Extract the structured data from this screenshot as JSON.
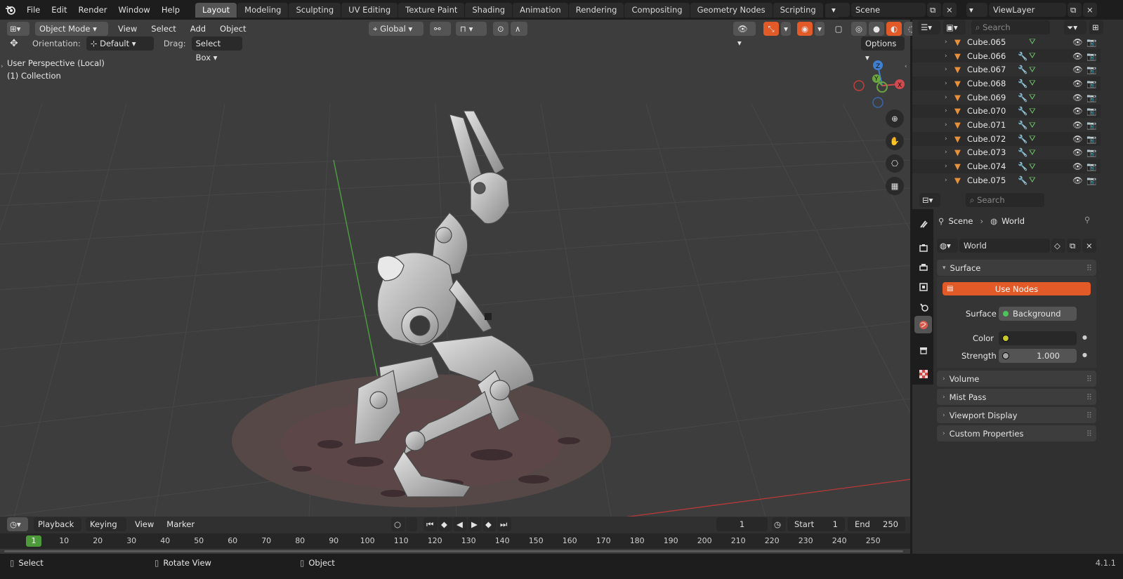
{
  "topbar": {
    "menus": [
      "File",
      "Edit",
      "Render",
      "Window",
      "Help"
    ],
    "tabs": [
      "Layout",
      "Modeling",
      "Sculpting",
      "UV Editing",
      "Texture Paint",
      "Shading",
      "Animation",
      "Rendering",
      "Compositing",
      "Geometry Nodes",
      "Scripting"
    ],
    "active_tab": "Layout",
    "add_label": "+",
    "scene_label": "Scene",
    "viewlayer_label": "ViewLayer"
  },
  "viewport": {
    "mode": "Object Mode",
    "menus": [
      "View",
      "Select",
      "Add",
      "Object"
    ],
    "transform_orientation": "Global",
    "orientation_label": "Orientation:",
    "orientation_value": "Default",
    "drag_label": "Drag:",
    "drag_value": "Select Box",
    "options_label": "Options",
    "overlay_title": "User Perspective (Local)",
    "overlay_collection": "(1) Collection",
    "gizmo": {
      "x": "X",
      "y": "Y",
      "z": "Z"
    }
  },
  "outliner": {
    "search_placeholder": "Search",
    "items": [
      {
        "name": "Cube.065",
        "modifier": false
      },
      {
        "name": "Cube.066",
        "modifier": true
      },
      {
        "name": "Cube.067",
        "modifier": true
      },
      {
        "name": "Cube.068",
        "modifier": true
      },
      {
        "name": "Cube.069",
        "modifier": true
      },
      {
        "name": "Cube.070",
        "modifier": true
      },
      {
        "name": "Cube.071",
        "modifier": true
      },
      {
        "name": "Cube.072",
        "modifier": true
      },
      {
        "name": "Cube.073",
        "modifier": true
      },
      {
        "name": "Cube.074",
        "modifier": true
      },
      {
        "name": "Cube.075",
        "modifier": true
      }
    ]
  },
  "properties": {
    "search_placeholder": "Search",
    "breadcrumb_scene": "Scene",
    "breadcrumb_world": "World",
    "world_name": "World",
    "surface_panel": "Surface",
    "use_nodes": "Use Nodes",
    "surface_label": "Surface",
    "surface_value": "Background",
    "color_label": "Color",
    "color_value": "#000000",
    "strength_label": "Strength",
    "strength_value": "1.000",
    "panels": [
      "Volume",
      "Mist Pass",
      "Viewport Display",
      "Custom Properties"
    ]
  },
  "timeline": {
    "playback": "Playback",
    "keying": "Keying",
    "view": "View",
    "marker": "Marker",
    "current_frame": "1",
    "start_label": "Start",
    "start_value": "1",
    "end_label": "End",
    "end_value": "250",
    "ruler": [
      "1",
      "10",
      "20",
      "30",
      "40",
      "50",
      "60",
      "70",
      "80",
      "90",
      "100",
      "110",
      "120",
      "130",
      "140",
      "150",
      "160",
      "170",
      "180",
      "190",
      "200",
      "210",
      "220",
      "230",
      "240",
      "250"
    ]
  },
  "status": {
    "select": "Select",
    "rotate": "Rotate View",
    "object": "Object",
    "version": "4.1.1"
  },
  "colors": {
    "accent": "#e35a29",
    "active_tab": "#545454",
    "header": "#1d1d1d"
  }
}
